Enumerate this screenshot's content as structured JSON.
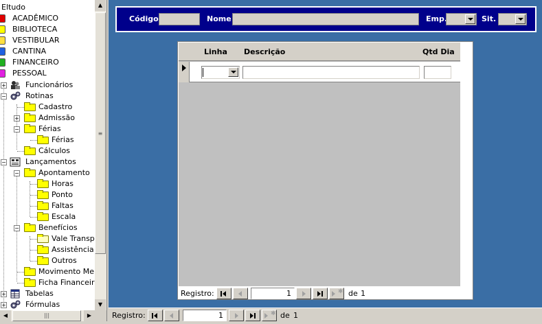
{
  "tree": {
    "root": "Eltudo",
    "nodes": [
      {
        "label": "ACADÊMICO",
        "icon": "red-book-icon",
        "color": "#e00000"
      },
      {
        "label": "BIBLIOTECA",
        "icon": "yellow-book-icon",
        "color": "#ffff00"
      },
      {
        "label": "VESTIBULAR",
        "icon": "yellow-book-icon",
        "color": "#ffe040"
      },
      {
        "label": "CANTINA",
        "icon": "blue-book-icon",
        "color": "#2060e0"
      },
      {
        "label": "FINANCEIRO",
        "icon": "green-book-icon",
        "color": "#20b020"
      },
      {
        "label": "PESSOAL",
        "icon": "magenta-book-icon",
        "color": "#e020e0"
      },
      {
        "label": "Funcionários",
        "icon": "people-icon",
        "expander": "+"
      },
      {
        "label": "Rotinas",
        "icon": "gears-icon",
        "expander": "-"
      },
      {
        "label": "Cadastro",
        "icon": "folder-icon"
      },
      {
        "label": "Admissão",
        "icon": "folder-icon",
        "expander": "+"
      },
      {
        "label": "Férias",
        "icon": "folder-icon",
        "expander": "-"
      },
      {
        "label": "Férias",
        "icon": "folder-icon"
      },
      {
        "label": "Cálculos",
        "icon": "folder-icon"
      },
      {
        "label": "Lançamentos",
        "icon": "ledger-icon",
        "expander": "-"
      },
      {
        "label": "Apontamento",
        "icon": "folder-icon",
        "expander": "-"
      },
      {
        "label": "Horas",
        "icon": "folder-icon"
      },
      {
        "label": "Ponto",
        "icon": "folder-icon"
      },
      {
        "label": "Faltas",
        "icon": "folder-icon"
      },
      {
        "label": "Escala",
        "icon": "folder-icon"
      },
      {
        "label": "Benefícios",
        "icon": "folder-icon",
        "expander": "-"
      },
      {
        "label": "Vale Transpo",
        "icon": "open-folder-icon"
      },
      {
        "label": "Assistência M",
        "icon": "folder-icon"
      },
      {
        "label": "Outros",
        "icon": "folder-icon"
      },
      {
        "label": "Movimento Mens",
        "icon": "folder-icon"
      },
      {
        "label": "Ficha Financeira",
        "icon": "folder-icon"
      },
      {
        "label": "Tabelas",
        "icon": "table-icon",
        "expander": "+"
      },
      {
        "label": "Fórmulas",
        "icon": "gears-icon",
        "expander": "+"
      }
    ]
  },
  "filters": {
    "codigo_label": "Código",
    "codigo_value": "",
    "nome_label": "Nome",
    "nome_value": "",
    "emp_label": "Emp.",
    "emp_value": "",
    "sit_label": "Sit.",
    "sit_value": ""
  },
  "subform": {
    "columns": [
      "Linha",
      "Descrição",
      "Qtd Dia"
    ],
    "row": {
      "linha": "",
      "descricao": "",
      "qtd_dia": ""
    },
    "nav": {
      "label": "Registro:",
      "current": "1",
      "of_label": "de",
      "total": "1"
    }
  },
  "main_nav": {
    "label": "Registro:",
    "current": "1",
    "of_label": "de",
    "total": "1"
  }
}
